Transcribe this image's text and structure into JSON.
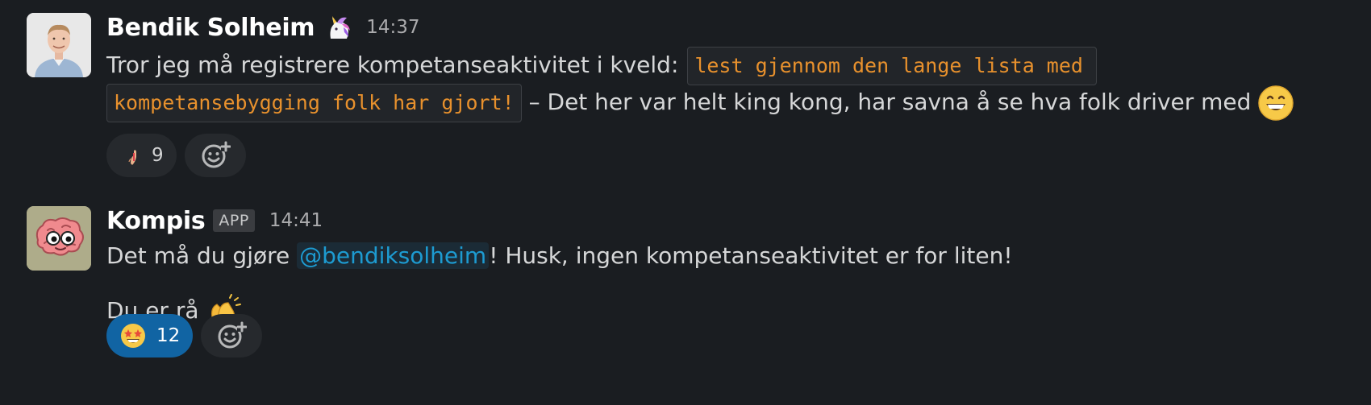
{
  "messages": [
    {
      "author": "Bendik Solheim",
      "status_emoji": "unicorn-icon",
      "time": "14:37",
      "line1_text": "Tror jeg må registrere kompetanseaktivitet i kveld:",
      "code_part1": "lest gjennom den lange lista med",
      "code_part2": "kompetansebygging folk har gjort!",
      "line2_text": "– Det her var helt king kong, har savna å se hva folk driver med",
      "inline_emoji": "grinning-face-icon",
      "reactions": [
        {
          "emoji": "flexed-biceps-icon",
          "count": "9",
          "active": false
        }
      ]
    },
    {
      "author": "Kompis",
      "badge": "APP",
      "time": "14:41",
      "line1_before": "Det må du gjøre",
      "mention": "@bendiksolheim",
      "line1_after": "! Husk, ingen kompetanseaktivitet er for liten!",
      "line2_text": "Du er rå",
      "inline_emoji": "clapping-hands-icon",
      "reactions": [
        {
          "emoji": "star-struck-icon",
          "count": "12",
          "active": true
        }
      ]
    }
  ],
  "colors": {
    "background": "#1a1d21",
    "code_text": "#e8912d",
    "mention_text": "#1d9bd1",
    "active_reaction": "#1164a3"
  }
}
